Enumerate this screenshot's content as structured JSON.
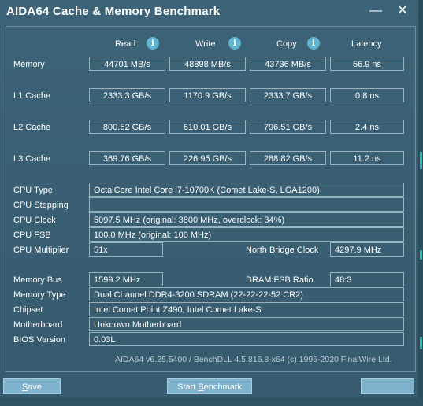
{
  "window": {
    "title": "AIDA64 Cache & Memory Benchmark",
    "minimize_glyph": "—",
    "close_glyph": "✕"
  },
  "columns": {
    "read": "Read",
    "write": "Write",
    "copy": "Copy",
    "latency": "Latency",
    "info_glyph": "i"
  },
  "bench": {
    "memory": {
      "label": "Memory",
      "read": "44701 MB/s",
      "write": "48898 MB/s",
      "copy": "43736 MB/s",
      "latency": "56.9 ns"
    },
    "l1": {
      "label": "L1 Cache",
      "read": "2333.3 GB/s",
      "write": "1170.9 GB/s",
      "copy": "2333.7 GB/s",
      "latency": "0.8 ns"
    },
    "l2": {
      "label": "L2 Cache",
      "read": "800.52 GB/s",
      "write": "610.01 GB/s",
      "copy": "796.51 GB/s",
      "latency": "2.4 ns"
    },
    "l3": {
      "label": "L3 Cache",
      "read": "369.76 GB/s",
      "write": "226.95 GB/s",
      "copy": "288.82 GB/s",
      "latency": "11.2 ns"
    }
  },
  "cpu": {
    "type_label": "CPU Type",
    "type_value": "OctalCore Intel Core i7-10700K  (Comet Lake-S, LGA1200)",
    "stepping_label": "CPU Stepping",
    "stepping_value": "",
    "clock_label": "CPU Clock",
    "clock_value": "5097.5 MHz  (original: 3800 MHz, overclock: 34%)",
    "fsb_label": "CPU FSB",
    "fsb_value": "100.0 MHz  (original: 100 MHz)",
    "multiplier_label": "CPU Multiplier",
    "multiplier_value": "51x",
    "nb_clock_label": "North Bridge Clock",
    "nb_clock_value": "4297.9 MHz"
  },
  "memory": {
    "bus_label": "Memory Bus",
    "bus_value": "1599.2 MHz",
    "ratio_label": "DRAM:FSB Ratio",
    "ratio_value": "48:3",
    "type_label": "Memory Type",
    "type_value": "Dual Channel DDR4-3200 SDRAM  (22-22-22-52 CR2)",
    "chipset_label": "Chipset",
    "chipset_value": "Intel Comet Point Z490, Intel Comet Lake-S",
    "motherboard_label": "Motherboard",
    "motherboard_value": "Unknown Motherboard",
    "bios_label": "BIOS Version",
    "bios_value": "0.03L"
  },
  "footer": {
    "version_text": "AIDA64 v6.25.5400 / BenchDLL 4.5.816.8-x64  (c) 1995-2020 FinalWire Ltd."
  },
  "buttons": {
    "save_mnemonic": "S",
    "save_rest": "ave",
    "start_prefix": "Start ",
    "start_mnemonic": "B",
    "start_rest": "enchmark"
  },
  "colors": {
    "background": "#3a5f73",
    "button": "#7fb2cc",
    "info_icon": "#5fb5d0",
    "edge_accent": "#1fc2b2"
  }
}
